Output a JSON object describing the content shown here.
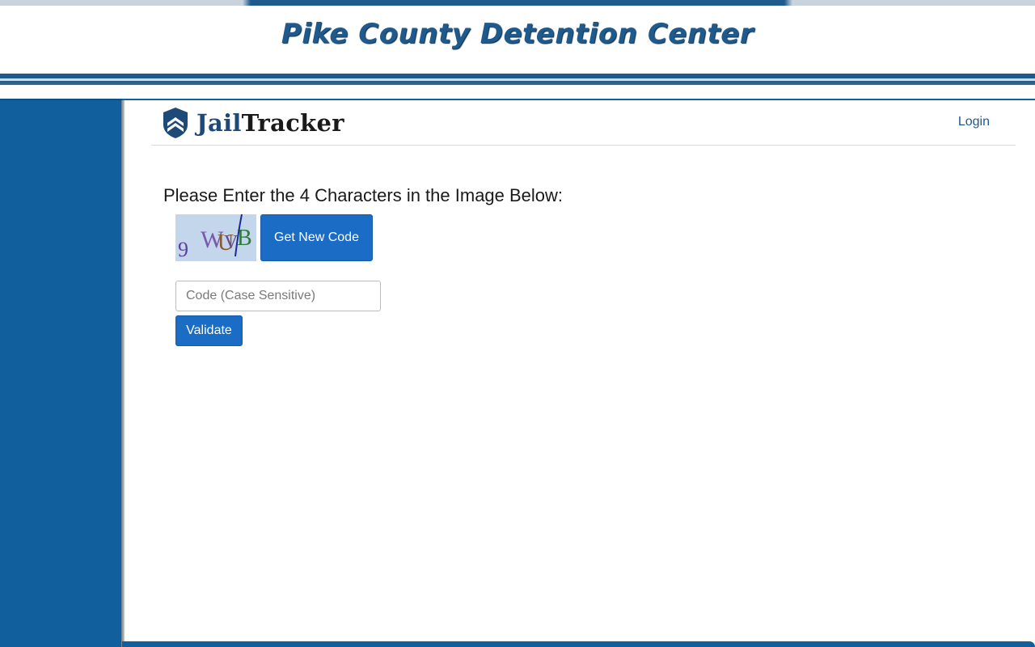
{
  "banner": {
    "title": "Pike County Detention Center"
  },
  "navbar": {
    "logo": {
      "part1": "Jail",
      "part2": "Tracker",
      "icon": "shield-icon"
    },
    "login_label": "Login"
  },
  "captcha": {
    "prompt": "Please Enter the 4 Characters in the Image Below:",
    "new_code_label": "Get New Code",
    "input_placeholder": "Code (Case Sensitive)",
    "input_value": "",
    "validate_label": "Validate"
  },
  "colors": {
    "brand_blue": "#11609d",
    "banner_title": "#1f5a8c",
    "button": "#1a6cc4"
  }
}
